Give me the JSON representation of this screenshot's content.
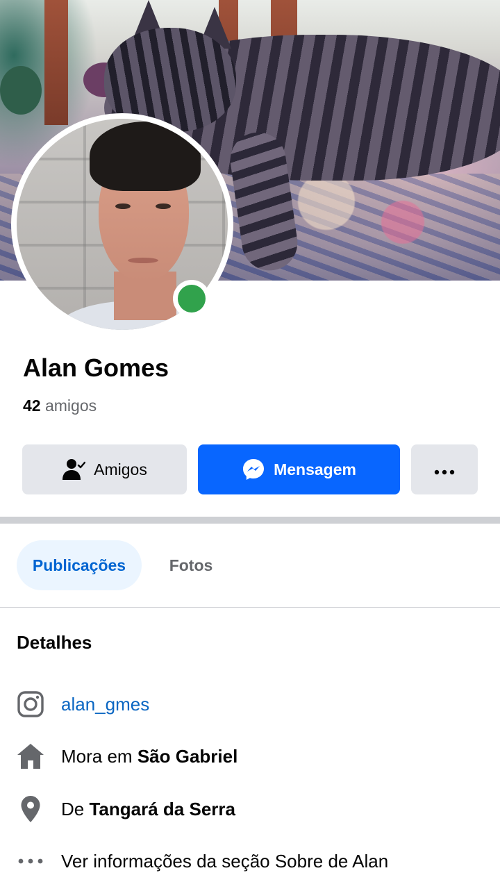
{
  "profile": {
    "name": "Alan Gomes",
    "friends_count": "42",
    "friends_label": "amigos",
    "online": true
  },
  "actions": {
    "friends_label": "Amigos",
    "message_label": "Mensagem",
    "more_label": "•••"
  },
  "tabs": [
    {
      "label": "Publicações",
      "active": true
    },
    {
      "label": "Fotos",
      "active": false
    }
  ],
  "details": {
    "title": "Detalhes",
    "instagram": "alan_gmes",
    "lives_prefix": "Mora em",
    "lives_in": "São Gabriel",
    "from_prefix": "De",
    "from": "Tangará da Serra",
    "see_about": "Ver informações da seção Sobre de Alan"
  },
  "colors": {
    "accent": "#0866ff",
    "online": "#31a24c",
    "secondary_button": "#e4e6eb",
    "link": "#0a66c2"
  },
  "icons": [
    "friends-check-icon",
    "messenger-icon",
    "more-icon",
    "instagram-icon",
    "home-icon",
    "location-pin-icon",
    "more-dots-icon"
  ]
}
